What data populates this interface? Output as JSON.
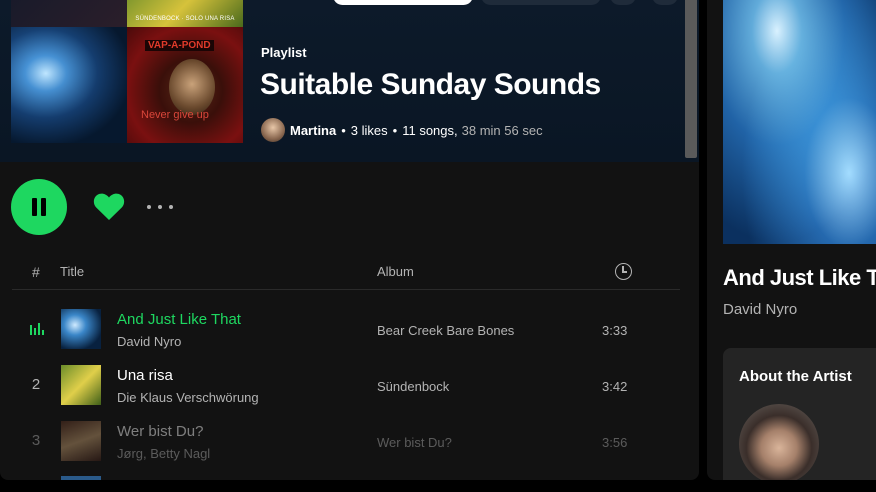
{
  "playlist": {
    "type_label": "Playlist",
    "title": "Suitable Sunday Sounds",
    "owner": "Martina",
    "likes": "3 likes",
    "songs": "11 songs,",
    "duration": "38 min 56 sec"
  },
  "cover_tiles": {
    "top_right_caption": "SÜNDENBOCK · SOLO UNA RISA",
    "bottom_right_top": "VAP-A-POND",
    "bottom_right_text": "Never give up"
  },
  "table": {
    "header": {
      "num": "#",
      "title": "Title",
      "album": "Album"
    },
    "rows": [
      {
        "num": "1",
        "title": "And Just Like That",
        "artist": "David Nyro",
        "album": "Bear Creek Bare Bones",
        "duration": "3:33",
        "playing": true
      },
      {
        "num": "2",
        "title": "Una risa",
        "artist": "Die Klaus Verschwörung",
        "album": "Sündenbock",
        "duration": "3:42",
        "playing": false
      },
      {
        "num": "3",
        "title": "Wer bist Du?",
        "artist": "Jørg, Betty Nagl",
        "album": "Wer bist Du?",
        "duration": "3:56",
        "playing": false
      }
    ]
  },
  "now_playing": {
    "title": "And Just Like That",
    "artist": "David Nyro",
    "about_title": "About the Artist"
  },
  "colors": {
    "accent": "#1ed760",
    "background": "#121212",
    "hero": "#0d1a2a"
  },
  "icons": {
    "play_pause": "pause-icon",
    "like": "heart-icon",
    "more": "more-options-icon",
    "duration": "clock-icon",
    "playing": "equalizer-icon"
  }
}
